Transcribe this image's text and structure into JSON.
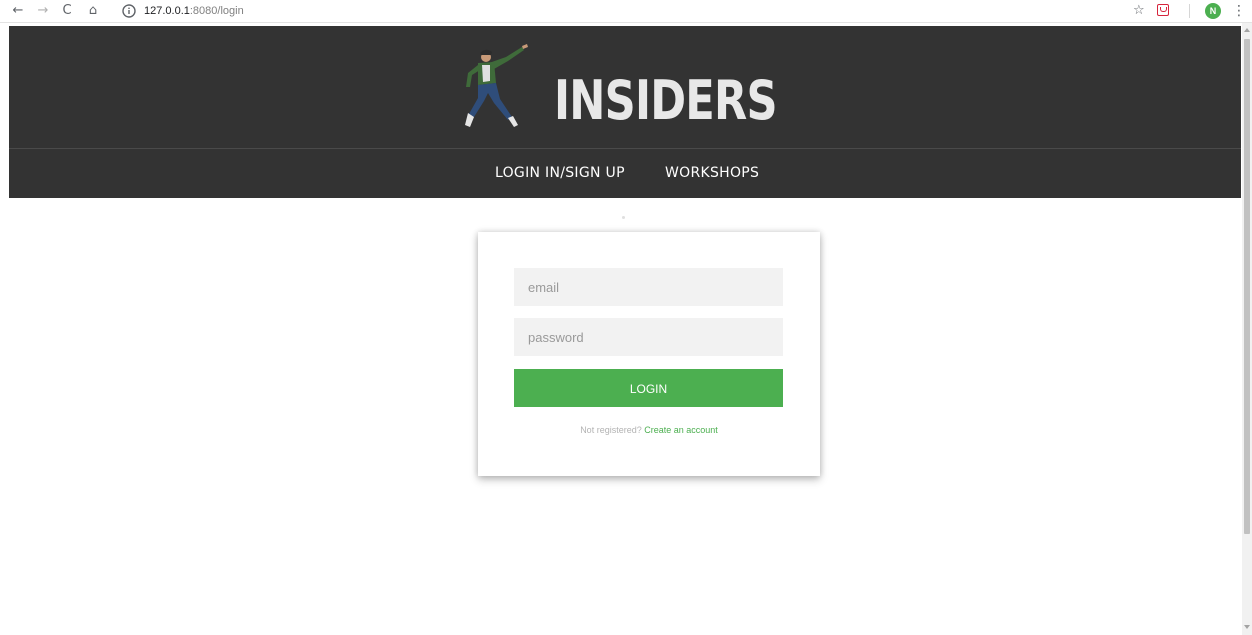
{
  "browser": {
    "back_icon": "←",
    "forward_icon": "→",
    "reload_icon": "C",
    "home_icon": "⌂",
    "url_host": "127.0.0.1",
    "url_rest": ":8080/login",
    "star_icon": "☆",
    "avatar_letter": "N",
    "menu_icon": "⋮"
  },
  "header": {
    "title": "INSIDERS"
  },
  "menu": {
    "login": "LOGIN IN/SIGN UP",
    "workshops": "WORKSHOPS"
  },
  "form": {
    "email_placeholder": "email",
    "password_placeholder": "password",
    "login_label": "LOGIN",
    "not_registered": "Not registered?",
    "create_account": "Create an account"
  },
  "colors": {
    "header_bg": "#333333",
    "accent": "#4caf50",
    "field_bg": "#f2f2f2"
  }
}
